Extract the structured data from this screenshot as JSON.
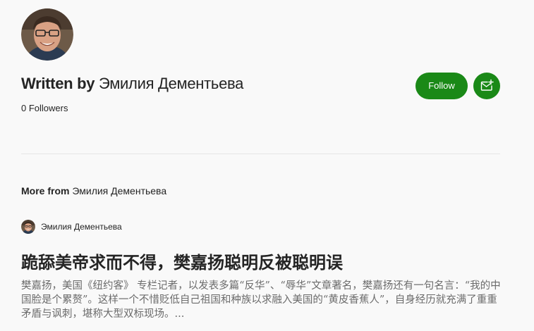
{
  "author": {
    "written_by_label": "Written by",
    "name": "Эмилия Дементьева",
    "followers": "0 Followers"
  },
  "actions": {
    "follow_label": "Follow"
  },
  "more_from": {
    "label": "More from",
    "name": "Эмилия Дементьева"
  },
  "article": {
    "author_name": "Эмилия Дементьева",
    "title": "跪舔美帝求而不得，樊嘉扬聪明反被聪明误",
    "excerpt": "樊嘉扬，美国《纽约客》 专栏记者，以发表多篇“反华”、“辱华”文章著名，樊嘉扬还有一句名言：“我的中国脸是个累赘”。这样一个不惜贬低自己祖国和种族以求融入美国的“黄皮香蕉人”，自身经历就充满了重重矛盾与讽刺，堪称大型双标现场。..."
  },
  "colors": {
    "accent": "#1a8917",
    "text": "#242424",
    "muted": "#6b6b6b",
    "divider": "#e6e6e6",
    "background": "#f9f9f9"
  },
  "icons": {
    "subscribe": "mail-plus-icon"
  }
}
